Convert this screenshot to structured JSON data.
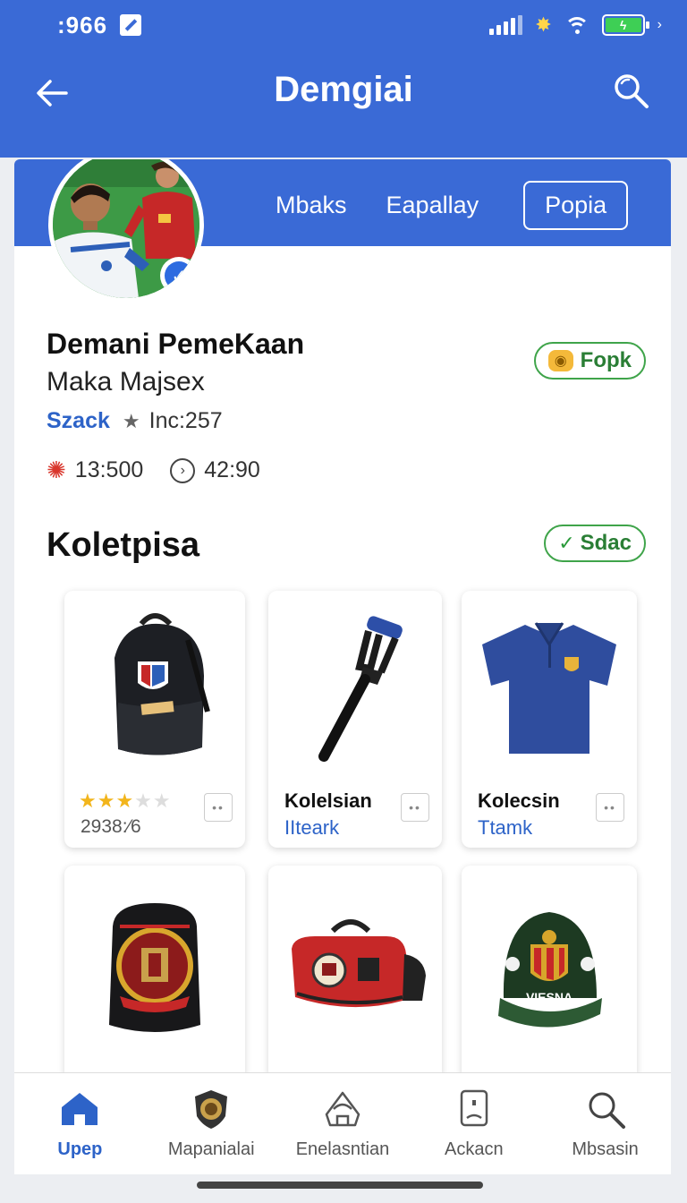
{
  "status_bar": {
    "time": ":966",
    "edit_icon": "edit-square-icon",
    "signal_icon": "signal-bars-icon",
    "spark_icon": "sparkle-icon",
    "wifi_icon": "wifi-icon",
    "battery_icon": "battery-charging-icon",
    "chevron": "›"
  },
  "app_bar": {
    "title": "Demgiai",
    "back_icon": "back-arrow-icon",
    "search_icon": "search-icon"
  },
  "profile": {
    "tabs": [
      {
        "label": "Mbaks"
      },
      {
        "label": "Eapallay"
      },
      {
        "label": "Popia"
      }
    ],
    "name": "Demani PemeKaan",
    "subname": "Maka Majsex",
    "link": "Szack",
    "rating_star": "★",
    "rating_text": "Inc:257",
    "stat_1": "13:500",
    "stat_2": "42:90",
    "follow_badge": "Fopk",
    "verified_mark": "✓"
  },
  "collection": {
    "title": "Koletpisa",
    "badge": "Sdac",
    "badge_mark": "✓"
  },
  "tiles": [
    {
      "stars": "★★★",
      "stars_off": "★★",
      "count": "2938:⁄6"
    },
    {
      "title": "Kolelsian",
      "subtitle": "IIteark"
    },
    {
      "title": "Kolecsin",
      "subtitle": "Ttamk"
    }
  ],
  "cap_text": "VIESNA",
  "bottom_nav": [
    {
      "label": "Upep",
      "icon": "home-icon"
    },
    {
      "label": "Mapanialai",
      "icon": "shield-badge-icon"
    },
    {
      "label": "Enelasntian",
      "icon": "tent-icon"
    },
    {
      "label": "Ackacn",
      "icon": "phone-card-icon"
    },
    {
      "label": "Mbsasin",
      "icon": "search-icon"
    }
  ],
  "colors": {
    "primary": "#3a6ad6",
    "link": "#2d63c8",
    "success": "#3fa44a",
    "star": "#f2b51c"
  }
}
